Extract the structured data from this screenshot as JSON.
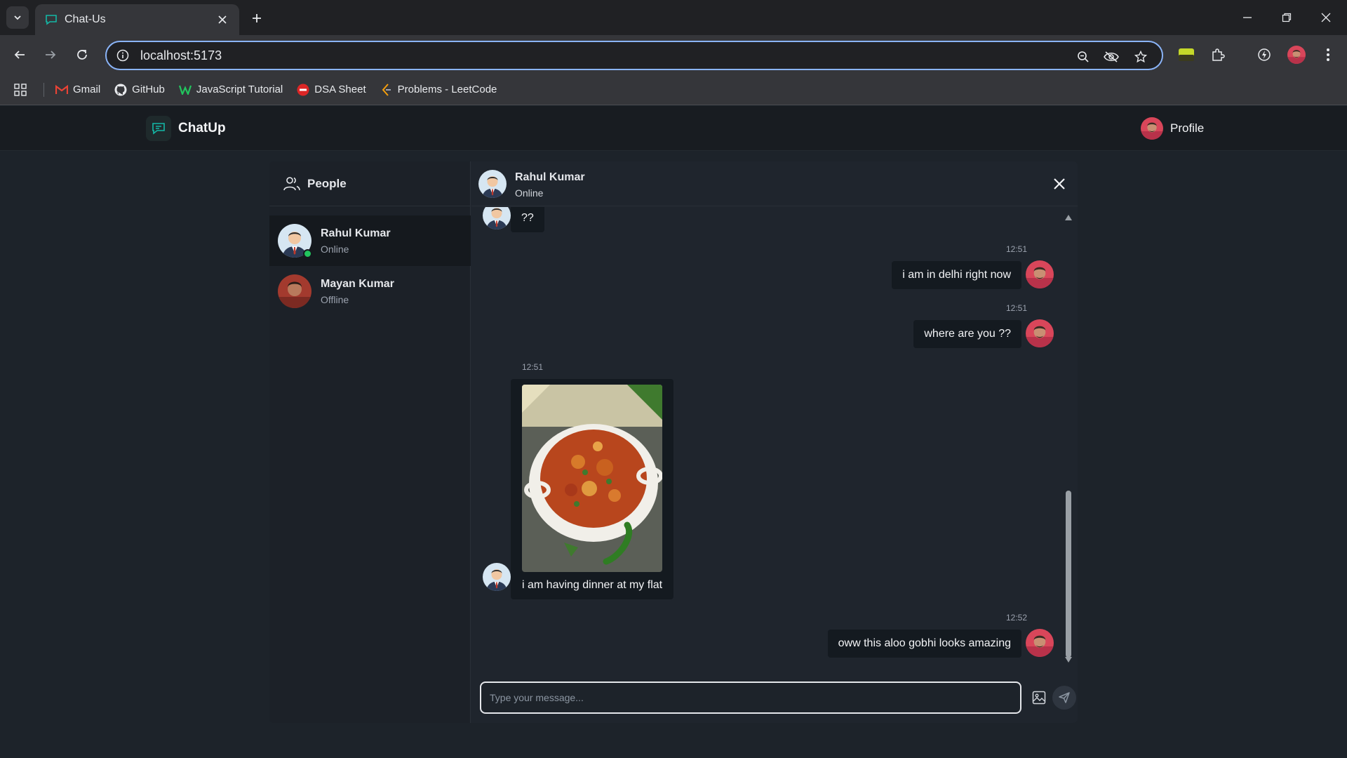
{
  "browser": {
    "tab_title": "Chat-Us",
    "url": "localhost:5173",
    "bookmarks": [
      {
        "label": "Gmail",
        "icon": "gmail-icon"
      },
      {
        "label": "GitHub",
        "icon": "github-icon"
      },
      {
        "label": "JavaScript Tutorial",
        "icon": "javascript-tutorial-icon"
      },
      {
        "label": "DSA Sheet",
        "icon": "tuf-icon"
      },
      {
        "label": "Problems - LeetCode",
        "icon": "leetcode-icon"
      }
    ]
  },
  "app": {
    "brand": "ChatUp",
    "profile_label": "Profile",
    "accent": "#14b8a6"
  },
  "sidebar": {
    "title": "People",
    "contacts": [
      {
        "name": "Rahul Kumar",
        "status": "Online",
        "active": true
      },
      {
        "name": "Mayan Kumar",
        "status": "Offline",
        "active": false
      }
    ]
  },
  "chat": {
    "contact_name": "Rahul Kumar",
    "contact_status": "Online",
    "messages": [
      {
        "from": "them",
        "text": "??",
        "time": ""
      },
      {
        "from": "me",
        "text": "i am in delhi right now",
        "time": "12:51"
      },
      {
        "from": "me",
        "text": "where are you ??",
        "time": "12:51"
      },
      {
        "from": "them",
        "text": "i am having dinner at my flat",
        "time": "12:51",
        "image": "aloo-gobhi-photo"
      },
      {
        "from": "me",
        "text": "oww this aloo gobhi looks amazing",
        "time": "12:52"
      }
    ],
    "input_placeholder": "Type your message..."
  }
}
